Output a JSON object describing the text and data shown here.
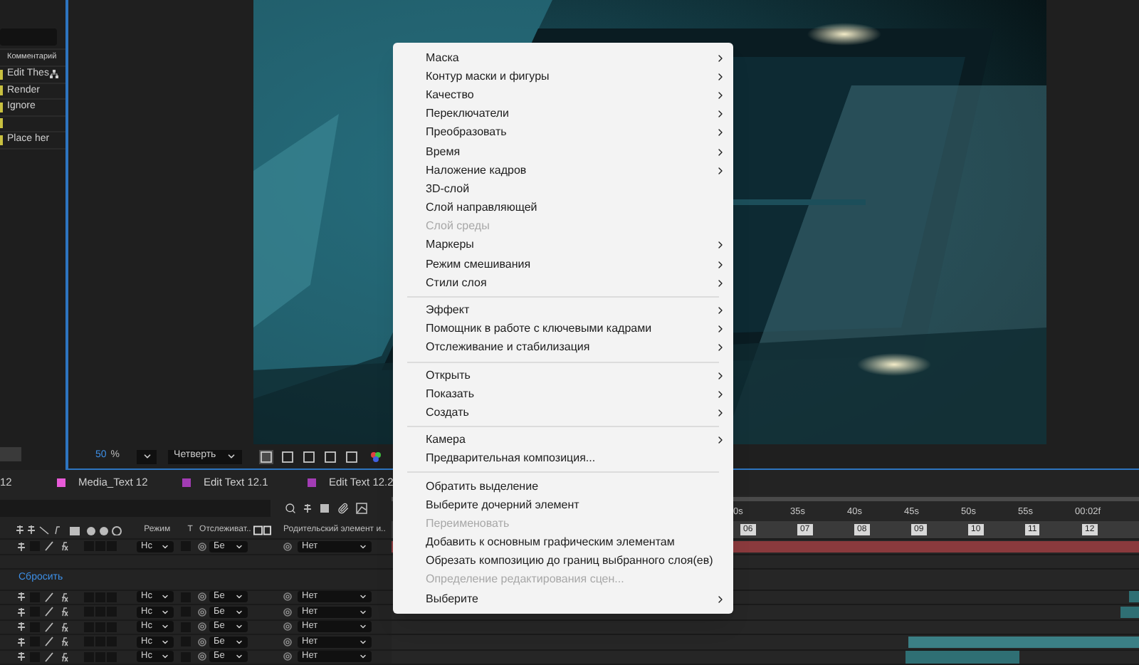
{
  "project_panel": {
    "column": "Комментарий",
    "rows": [
      {
        "text": "Edit Thes",
        "linked": true
      },
      {
        "text": "Render",
        "linked": false
      },
      {
        "text": "Ignore",
        "linked": false
      },
      {
        "linked": false
      },
      {
        "text": "Place her",
        "linked": false
      }
    ]
  },
  "viewer": {
    "zoom": "50",
    "zoom_unit": "%",
    "resolution": "Четверть"
  },
  "comp_tabs": [
    {
      "label": "12"
    },
    {
      "label": "Media_Text 12",
      "color": "#e85ad8"
    },
    {
      "label": "Edit Text 12.1",
      "color": "#a23cb4"
    },
    {
      "label": "Edit Text 12.2",
      "color": "#a23cb4"
    }
  ],
  "timeline": {
    "columns": [
      {
        "label": "Режим"
      },
      {
        "label": "T"
      },
      {
        "label": "Отслеживат.."
      },
      {
        "label": "Родительский элемент и.."
      }
    ],
    "rows": [
      {
        "kind": "layer",
        "mode": "Нс",
        "track_matte": "Бе",
        "parent": "Нет"
      },
      {
        "kind": "blank"
      },
      {
        "kind": "reset",
        "label": "Сбросить"
      },
      {
        "kind": "layer",
        "mode": "Нс",
        "track_matte": "Бе",
        "parent": "Нет"
      },
      {
        "kind": "layer",
        "mode": "Нс",
        "track_matte": "Бе",
        "parent": "Нет"
      },
      {
        "kind": "layer",
        "mode": "Нс",
        "track_matte": "Бе",
        "parent": "Нет"
      },
      {
        "kind": "layer",
        "mode": "Нс",
        "track_matte": "Бе",
        "parent": "Нет"
      },
      {
        "kind": "layer",
        "mode": "Нс",
        "track_matte": "Бе",
        "parent": "Нет"
      }
    ],
    "ruler": [
      "0s",
      "35s",
      "40s",
      "45s",
      "50s",
      "55s",
      "00:02f"
    ],
    "markers": [
      "06",
      "07",
      "08",
      "09",
      "10",
      "11",
      "12"
    ]
  },
  "context_menu": {
    "groups": [
      [
        {
          "label": "Маска",
          "submenu": true,
          "disabled": false
        },
        {
          "label": "Контур маски и фигуры",
          "submenu": true,
          "disabled": false
        },
        {
          "label": "Качество",
          "submenu": true,
          "disabled": false
        },
        {
          "label": "Переключатели",
          "submenu": true,
          "disabled": false
        },
        {
          "label": "Преобразовать",
          "submenu": true,
          "disabled": false
        },
        {
          "label": "Время",
          "submenu": true,
          "disabled": false
        },
        {
          "label": "Наложение кадров",
          "submenu": true,
          "disabled": false
        },
        {
          "label": "3D-слой",
          "submenu": false,
          "disabled": false
        },
        {
          "label": "Слой направляющей",
          "submenu": false,
          "disabled": false
        },
        {
          "label": "Слой среды",
          "submenu": false,
          "disabled": true
        },
        {
          "label": "Маркеры",
          "submenu": true,
          "disabled": false
        },
        {
          "label": "Режим смешивания",
          "submenu": true,
          "disabled": false
        },
        {
          "label": "Стили слоя",
          "submenu": true,
          "disabled": false
        }
      ],
      [
        {
          "label": "Эффект",
          "submenu": true,
          "disabled": false
        },
        {
          "label": "Помощник в работе с ключевыми кадрами",
          "submenu": true,
          "disabled": false
        },
        {
          "label": "Отслеживание и стабилизация",
          "submenu": true,
          "disabled": false
        }
      ],
      [
        {
          "label": "Открыть",
          "submenu": true,
          "disabled": false
        },
        {
          "label": "Показать",
          "submenu": true,
          "disabled": false
        },
        {
          "label": "Создать",
          "submenu": true,
          "disabled": false
        }
      ],
      [
        {
          "label": "Камера",
          "submenu": true,
          "disabled": false
        },
        {
          "label": "Предварительная композиция...",
          "submenu": false,
          "disabled": false
        }
      ],
      [
        {
          "label": "Обратить выделение",
          "submenu": false,
          "disabled": false
        },
        {
          "label": "Выберите дочерний элемент",
          "submenu": false,
          "disabled": false
        },
        {
          "label": "Переименовать",
          "submenu": false,
          "disabled": true
        },
        {
          "label": "Добавить к основным графическим элементам",
          "submenu": false,
          "disabled": false
        },
        {
          "label": "Обрезать композицию до границ выбранного слоя(ев)",
          "submenu": false,
          "disabled": false
        },
        {
          "label": "Определение редактирования сцен...",
          "submenu": false,
          "disabled": true
        },
        {
          "label": "Выберите",
          "submenu": true,
          "disabled": false
        }
      ]
    ]
  }
}
